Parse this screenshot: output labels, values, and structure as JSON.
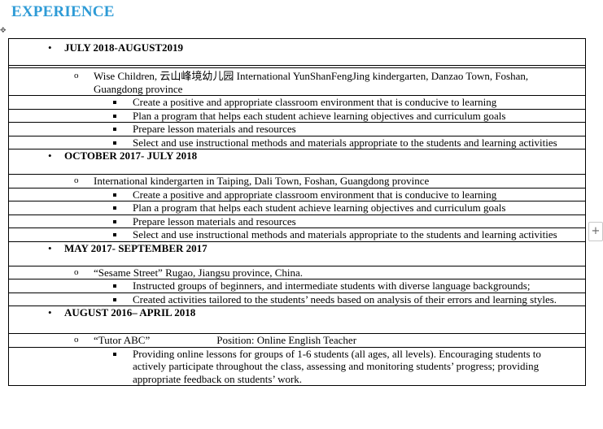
{
  "heading": "EXPERIENCE",
  "entries": [
    {
      "period": "JULY 2018-AUGUST2019",
      "employer": "Wise Children, 云山峰境幼儿园 International YunShanFengJing kindergarten, Danzao Town, Foshan, Guangdong province",
      "bullets": [
        "Create a positive and appropriate classroom environment that is conducive to learning",
        "Plan a program that helps each student achieve learning objectives and curriculum goals",
        "Prepare lesson materials and resources",
        "Select and use instructional methods and materials appropriate to the students and learning activities"
      ]
    },
    {
      "period": "OCTOBER 2017- JULY 2018",
      "employer": "International kindergarten in Taiping, Dali Town, Foshan, Guangdong province",
      "bullets": [
        "Create a positive and appropriate classroom environment that is conducive to learning",
        "Plan a program that helps each student achieve learning objectives and curriculum goals",
        "Prepare lesson materials and resources",
        "Select and use instructional methods and materials appropriate to the students and learning activities"
      ]
    },
    {
      "period": "MAY 2017- SEPTEMBER 2017",
      "employer": "“Sesame Street” Rugao, Jiangsu province, China.",
      "bullets": [
        "Instructed groups of beginners, and intermediate students with diverse language backgrounds;",
        "Created activities tailored to the students’ needs based on analysis of their errors and learning styles."
      ]
    },
    {
      "period": "AUGUST 2016– APRIL 2018",
      "employer": "“Tutor ABC”",
      "position": "Position: Online English Teacher",
      "bullets": [
        "Providing online lessons for groups of 1-6 students (all ages, all levels). Encouraging students to actively participate throughout the class, assessing and monitoring students’ progress; providing appropriate feedback on students’ work."
      ]
    }
  ],
  "icons": {
    "move_handle": "table-move-handle-icon",
    "add_column": "plus-icon"
  },
  "colors": {
    "heading": "#2E9BD6",
    "border": "#000000"
  }
}
